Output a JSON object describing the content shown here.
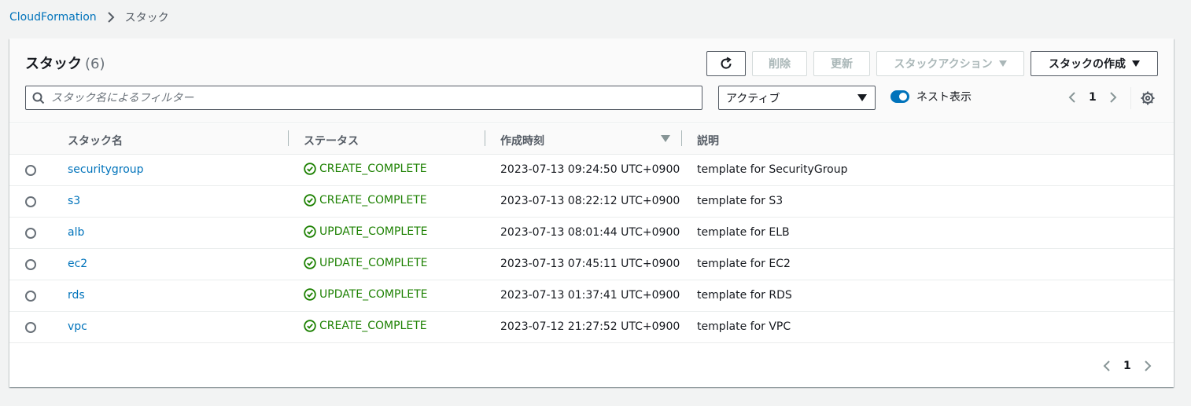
{
  "breadcrumb": {
    "root": "CloudFormation",
    "current": "スタック"
  },
  "header": {
    "title": "スタック",
    "count": "(6)",
    "buttons": {
      "refresh_icon": "refresh-icon",
      "delete": "削除",
      "update": "更新",
      "stack_actions": "スタックアクション",
      "create_stack": "スタックの作成"
    }
  },
  "filter": {
    "search_placeholder": "スタック名によるフィルター",
    "status_select": "アクティブ",
    "nested_toggle_label": "ネスト表示",
    "nested_toggle_on": true
  },
  "pagination": {
    "page": "1"
  },
  "table": {
    "columns": [
      "スタック名",
      "ステータス",
      "作成時刻",
      "説明"
    ],
    "rows": [
      {
        "name": "securitygroup",
        "status": "CREATE_COMPLETE",
        "created": "2023-07-13 09:24:50 UTC+0900",
        "description": "template for SecurityGroup"
      },
      {
        "name": "s3",
        "status": "CREATE_COMPLETE",
        "created": "2023-07-13 08:22:12 UTC+0900",
        "description": "template for S3"
      },
      {
        "name": "alb",
        "status": "UPDATE_COMPLETE",
        "created": "2023-07-13 08:01:44 UTC+0900",
        "description": "template for ELB"
      },
      {
        "name": "ec2",
        "status": "UPDATE_COMPLETE",
        "created": "2023-07-13 07:45:11 UTC+0900",
        "description": "template for EC2"
      },
      {
        "name": "rds",
        "status": "UPDATE_COMPLETE",
        "created": "2023-07-13 01:37:41 UTC+0900",
        "description": "template for RDS"
      },
      {
        "name": "vpc",
        "status": "CREATE_COMPLETE",
        "created": "2023-07-12 21:27:52 UTC+0900",
        "description": "template for VPC"
      }
    ]
  },
  "colors": {
    "link": "#0073bb",
    "success": "#1d8102",
    "toggle": "#0073bb"
  }
}
